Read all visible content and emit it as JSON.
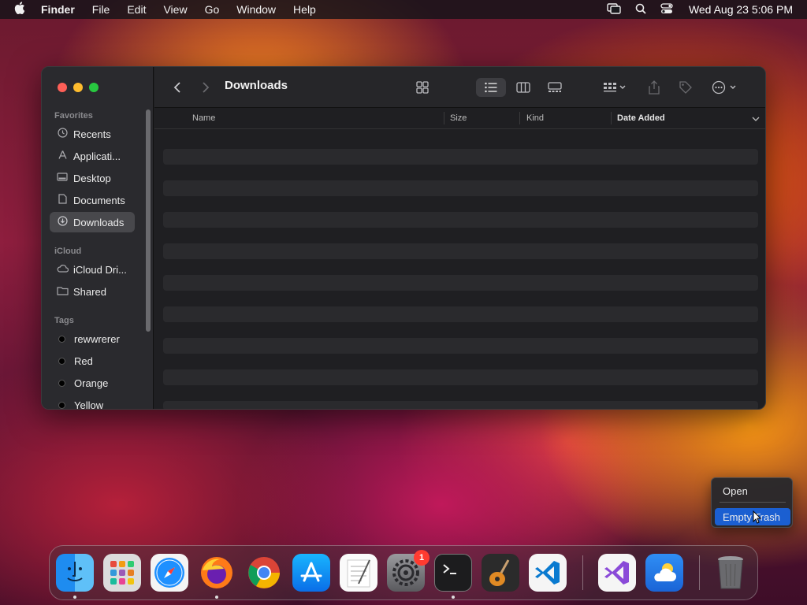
{
  "menubar": {
    "app": "Finder",
    "items": [
      "File",
      "Edit",
      "View",
      "Go",
      "Window",
      "Help"
    ],
    "clock": "Wed Aug 23  5:06 PM"
  },
  "finder": {
    "title": "Downloads",
    "sidebar": {
      "favorites_label": "Favorites",
      "favorites": [
        {
          "label": "Recents",
          "icon": "clock-icon"
        },
        {
          "label": "Applicati...",
          "icon": "applications-icon"
        },
        {
          "label": "Desktop",
          "icon": "desktop-icon"
        },
        {
          "label": "Documents",
          "icon": "document-icon"
        },
        {
          "label": "Downloads",
          "icon": "download-icon",
          "selected": true
        }
      ],
      "icloud_label": "iCloud",
      "icloud": [
        {
          "label": "iCloud Dri...",
          "icon": "cloud-icon"
        },
        {
          "label": "Shared",
          "icon": "shared-folder-icon"
        }
      ],
      "tags_label": "Tags",
      "tags": [
        {
          "label": "rewwrerer"
        },
        {
          "label": "Red"
        },
        {
          "label": "Orange"
        },
        {
          "label": "Yellow"
        }
      ]
    },
    "columns": {
      "name": "Name",
      "size": "Size",
      "kind": "Kind",
      "date_added": "Date Added"
    }
  },
  "context_menu": {
    "open": "Open",
    "empty_trash": "Empty Trash"
  },
  "dock": {
    "apps": [
      {
        "name": "Finder",
        "icon": "finder-icon"
      },
      {
        "name": "Launchpad",
        "icon": "launchpad-icon"
      },
      {
        "name": "Safari",
        "icon": "safari-icon"
      },
      {
        "name": "Firefox",
        "icon": "firefox-icon"
      },
      {
        "name": "Chrome",
        "icon": "chrome-icon"
      },
      {
        "name": "App Store",
        "icon": "app-store-icon"
      },
      {
        "name": "TextEdit",
        "icon": "textedit-icon"
      },
      {
        "name": "System Settings",
        "icon": "system-settings-icon",
        "badge": "1"
      },
      {
        "name": "Terminal",
        "icon": "terminal-icon"
      },
      {
        "name": "GarageBand",
        "icon": "garageband-icon"
      },
      {
        "name": "VS Code",
        "icon": "vscode-icon"
      },
      {
        "name": "Visual Studio",
        "icon": "visual-studio-icon"
      },
      {
        "name": "Weather",
        "icon": "weather-icon"
      },
      {
        "name": "Trash",
        "icon": "trash-icon"
      }
    ]
  }
}
